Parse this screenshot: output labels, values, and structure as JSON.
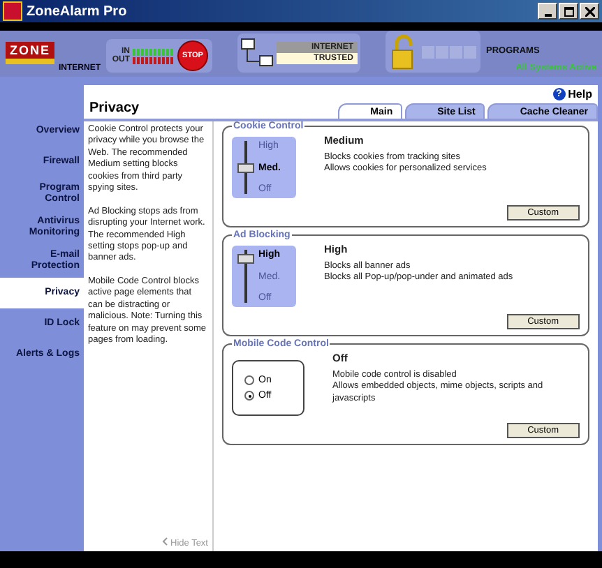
{
  "window": {
    "title": "ZoneAlarm Pro"
  },
  "header": {
    "logo": "ZONE",
    "internet_label": "INTERNET",
    "in_label": "IN",
    "out_label": "OUT",
    "stop": "STOP",
    "zones": [
      {
        "label": "INTERNET",
        "selected": false
      },
      {
        "label": "TRUSTED",
        "selected": true
      }
    ],
    "programs": "PROGRAMS",
    "status": "All Systems Active"
  },
  "help_icon": "?",
  "help": "Help",
  "sidebar": {
    "items": [
      {
        "label": "Overview",
        "selected": false
      },
      {
        "label": "Firewall",
        "selected": false
      },
      {
        "label": "Program Control",
        "selected": false
      },
      {
        "label": "Antivirus Monitoring",
        "selected": false
      },
      {
        "label": "E-mail Protection",
        "selected": false
      },
      {
        "label": "Privacy",
        "selected": true
      },
      {
        "label": "ID Lock",
        "selected": false
      },
      {
        "label": "Alerts & Logs",
        "selected": false
      }
    ]
  },
  "page_title": "Privacy",
  "tabs": [
    {
      "label": "Main",
      "selected": true
    },
    {
      "label": "Site List",
      "selected": false
    },
    {
      "label": "Cache Cleaner",
      "selected": false
    }
  ],
  "descriptions": [
    "Cookie Control protects your privacy while you browse the Web. The recommended Medium setting blocks cookies from third party spying sites.",
    "Ad Blocking stops ads from disrupting your Internet work. The recommended High setting stops pop-up and banner ads.",
    "Mobile Code Control blocks active page elements that can be distracting or malicious. Note: Turning this feature on may prevent some pages from loading."
  ],
  "hide_text": "Hide Text",
  "groups": [
    {
      "title": "Cookie Control",
      "kind": "slider",
      "options": [
        {
          "label": "High",
          "selected": false
        },
        {
          "label": "Med.",
          "selected": true
        },
        {
          "label": "Off",
          "selected": false
        }
      ],
      "setting": "Medium",
      "lines": [
        "Blocks cookies from tracking sites",
        "Allows cookies for personalized services"
      ],
      "button": "Custom"
    },
    {
      "title": "Ad Blocking",
      "kind": "slider",
      "options": [
        {
          "label": "High",
          "selected": true
        },
        {
          "label": "Med.",
          "selected": false
        },
        {
          "label": "Off",
          "selected": false
        }
      ],
      "setting": "High",
      "lines": [
        "Blocks all banner ads",
        "Blocks all Pop-up/pop-under and animated ads"
      ],
      "button": "Custom"
    },
    {
      "title": "Mobile Code Control",
      "kind": "radio",
      "options": [
        {
          "label": "On",
          "selected": false
        },
        {
          "label": "Off",
          "selected": true
        }
      ],
      "setting": "Off",
      "lines": [
        "Mobile code control is disabled",
        "Allows embedded objects, mime objects, scripts and javascripts"
      ],
      "button": "Custom"
    }
  ]
}
